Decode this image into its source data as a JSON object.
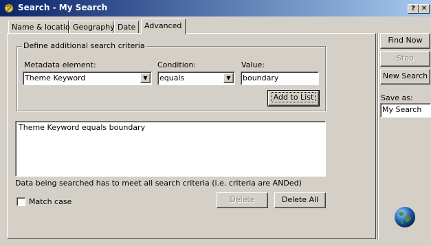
{
  "window": {
    "title": "Search - My Search",
    "help_btn": "?",
    "close_btn": "✕"
  },
  "tabs": [
    {
      "label": "Name & location"
    },
    {
      "label": "Geography"
    },
    {
      "label": "Date"
    },
    {
      "label": "Advanced"
    }
  ],
  "criteria_group": {
    "title": "Define additional search criteria",
    "metadata_label": "Metadata element:",
    "metadata_value": "Theme Keyword",
    "condition_label": "Condition:",
    "condition_value": "equals",
    "value_label": "Value:",
    "value_text": "boundary",
    "add_button": "Add to List"
  },
  "criteria_list": [
    "Theme Keyword equals boundary"
  ],
  "note": "Data being searched has to meet all search criteria (i.e. criteria are ANDed)",
  "match_case": {
    "label": "Match case",
    "checked": false
  },
  "delete_button": "Delete",
  "delete_all_button": "Delete All",
  "sidebar": {
    "find_now": "Find Now",
    "stop": "Stop",
    "new_search": "New Search",
    "save_as_label": "Save as:",
    "save_as_value": "My Search"
  },
  "colors": {
    "titlebar_start": "#0a246a",
    "titlebar_end": "#a6caf0",
    "face": "#d4d0c8"
  }
}
